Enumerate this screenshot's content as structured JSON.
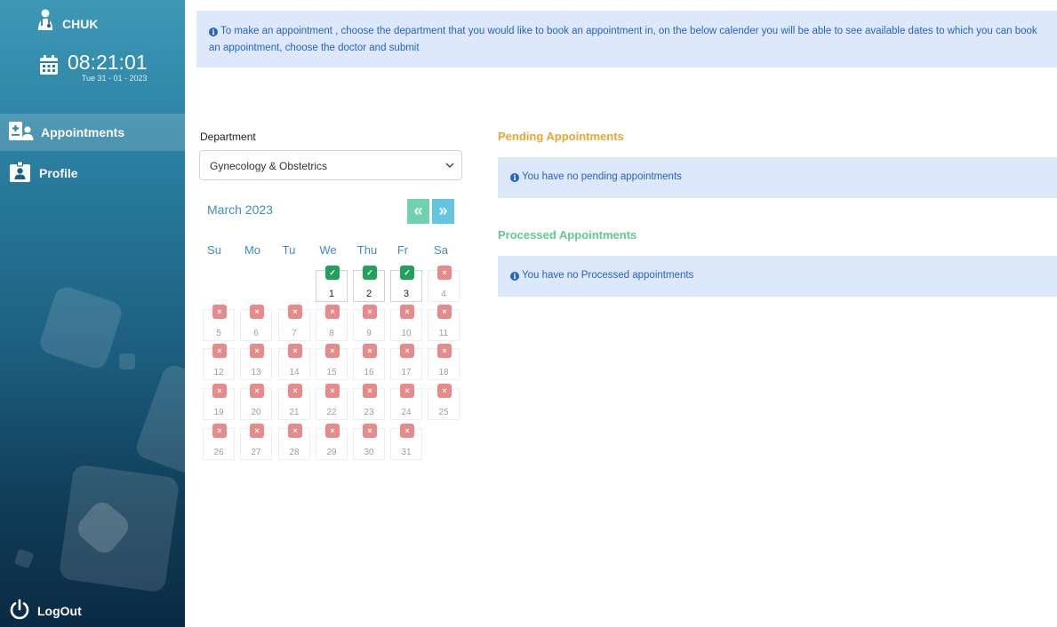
{
  "sidebar": {
    "brand": "CHUK",
    "clock_time": "08:21:01",
    "clock_date": "Tue 31 - 01 - 2023",
    "items": [
      {
        "label": "Appointments",
        "icon": "appointments-icon",
        "active": true
      },
      {
        "label": "Profile",
        "icon": "profile-badge-icon",
        "active": false
      }
    ],
    "logout_label": "LogOut"
  },
  "banner": {
    "text": "To make an appointment , choose the department that you would like to book an appointment in, on the below calender you will be able to see available dates to which you can book an appointment, choose the doctor and submit"
  },
  "department": {
    "label": "Department",
    "selected": "Gynecology & Obstetrics"
  },
  "calendar": {
    "month_label": "March 2023",
    "prev_label": "«",
    "next_label": "»",
    "weekdays": [
      "Su",
      "Mo",
      "Tu",
      "We",
      "Thu",
      "Fr",
      "Sa"
    ],
    "first_weekday_index": 3,
    "days_in_month": 31,
    "available_days": [
      1,
      2,
      3
    ],
    "available_mark": "✓",
    "unavailable_mark": "×",
    "colors": {
      "available": "#22a15a",
      "unavailable": "#e88a8a"
    }
  },
  "pending": {
    "title": "Pending Appointments",
    "message": "You have no pending appointments"
  },
  "processed": {
    "title": "Processed Appointments",
    "message": "You have no Processed appointments"
  }
}
